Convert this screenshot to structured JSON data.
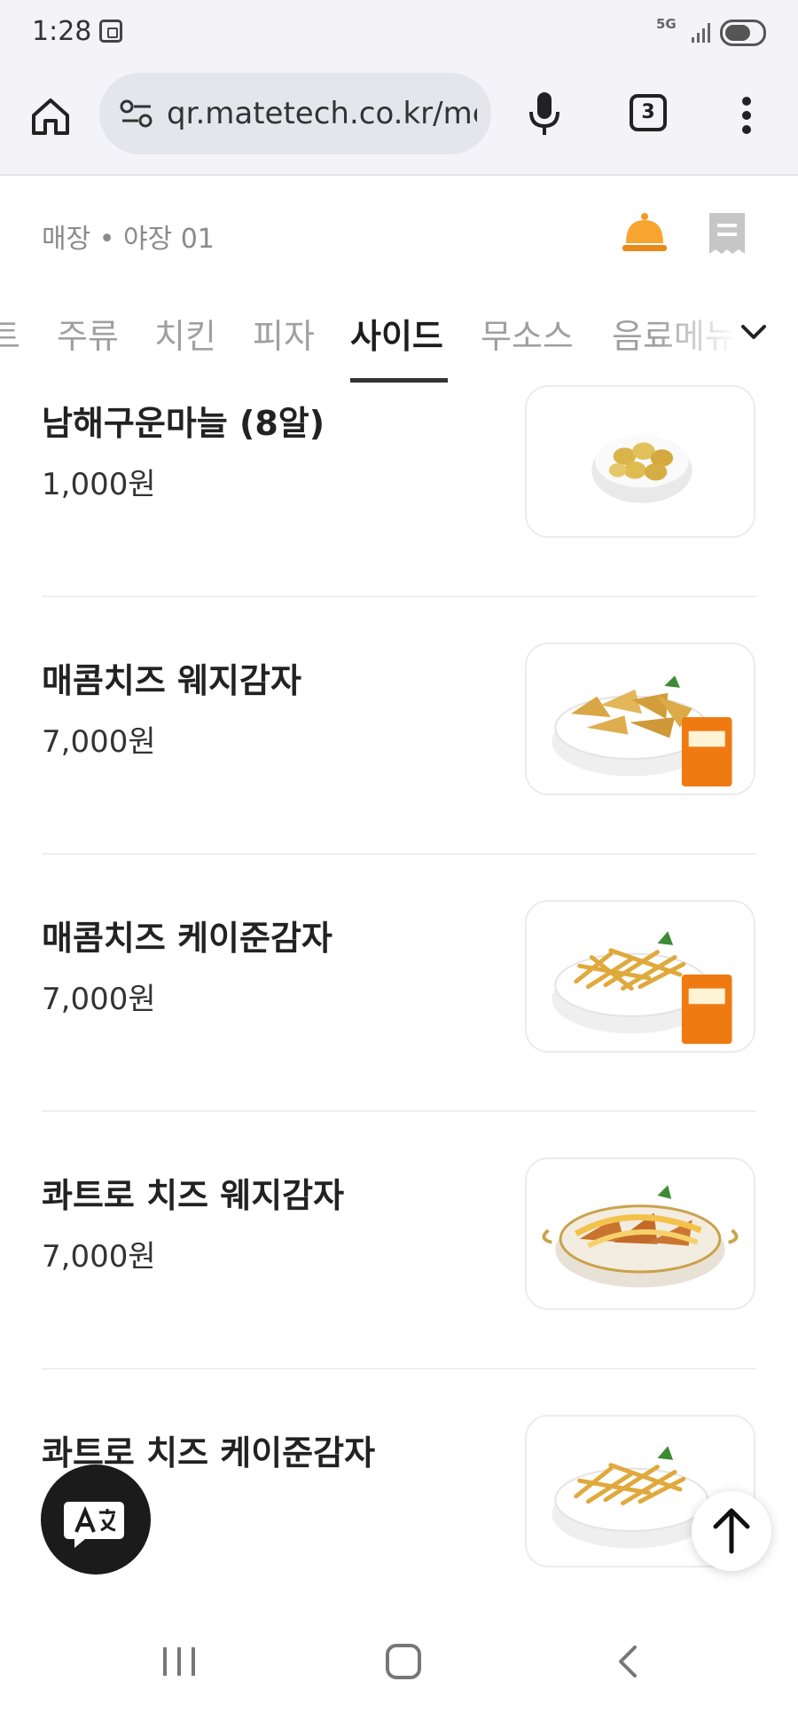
{
  "status_bar": {
    "time": "1:28",
    "network": "5G"
  },
  "browser": {
    "url": "qr.matetech.co.kr/me",
    "tab_count": "3"
  },
  "store": {
    "name": "매장 • 야장 01"
  },
  "categories": [
    {
      "label": "트"
    },
    {
      "label": "주류"
    },
    {
      "label": "치킨"
    },
    {
      "label": "피자"
    },
    {
      "label": "사이드",
      "active": true
    },
    {
      "label": "무소스"
    },
    {
      "label": "음료메뉴"
    }
  ],
  "items": [
    {
      "name": "남해구운마늘 (8알)",
      "price": "1,000원",
      "image": "roasted-garlic-bowl"
    },
    {
      "name": "매콤치즈 웨지감자",
      "price": "7,000원",
      "image": "wedge-potato-dish"
    },
    {
      "name": "매콤치즈 케이준감자",
      "price": "7,000원",
      "image": "cajun-fries-dish"
    },
    {
      "name": "콰트로 치즈 웨지감자",
      "price": "7,000원",
      "image": "cheese-wedge-dish"
    },
    {
      "name": "콰트로 치즈 케이준감자",
      "price": "",
      "image": "cheese-cajun-fries-dish"
    }
  ],
  "colors": {
    "accent": "#f39a1e",
    "active_tab": "#1d1d1d",
    "inactive_tab": "#a0a0a0"
  },
  "icons": {
    "home": "home-icon",
    "site_settings": "tune-icon",
    "mic": "mic-icon",
    "tabs": "tabs-icon",
    "menu": "kebab-menu-icon",
    "bell": "bell-icon",
    "receipt": "receipt-icon",
    "expand": "chevron-down-icon",
    "translate": "translate-icon",
    "scroll_top": "arrow-up-icon"
  }
}
